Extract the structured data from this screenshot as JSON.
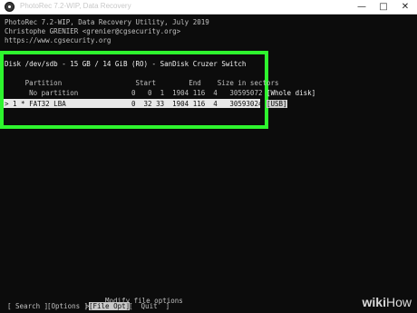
{
  "window": {
    "title": "PhotoRec 7.2-WIP, Data Recovery",
    "minimize": "—",
    "maximize": "□",
    "close": "✕"
  },
  "header": {
    "line1": "PhotoRec 7.2-WIP, Data Recovery Utility, July 2019",
    "line2": "Christophe GRENIER <grenier@cgsecurity.org>",
    "line3": "https://www.cgsecurity.org"
  },
  "disk": {
    "title": "Disk /dev/sdb - 15 GB / 14 GiB (RO) - SanDisk Cruzer Switch",
    "columns_header": "     Partition                  Start        End    Size in sectors",
    "rows": [
      {
        "text": "      No partition             0   0  1  1904 116  4   30595072 ",
        "tag": "[Whole disk]"
      },
      {
        "text": "> 1 * FAT32 LBA                0  32 33  1904 116  4   30593024 ",
        "tag": "[USB]"
      }
    ]
  },
  "menu": {
    "search": "[ Search ]",
    "options": "[Options ]",
    "file_opt": "[File Opt]",
    "file_opt_prefix": ">",
    "quit": "[  Quit  ]",
    "hint": "Modify file options"
  },
  "watermark": {
    "wiki": "wiki",
    "how": "How"
  },
  "colors": {
    "highlight_frame": "#2ef52e",
    "terminal_bg": "#0c0c0c"
  }
}
